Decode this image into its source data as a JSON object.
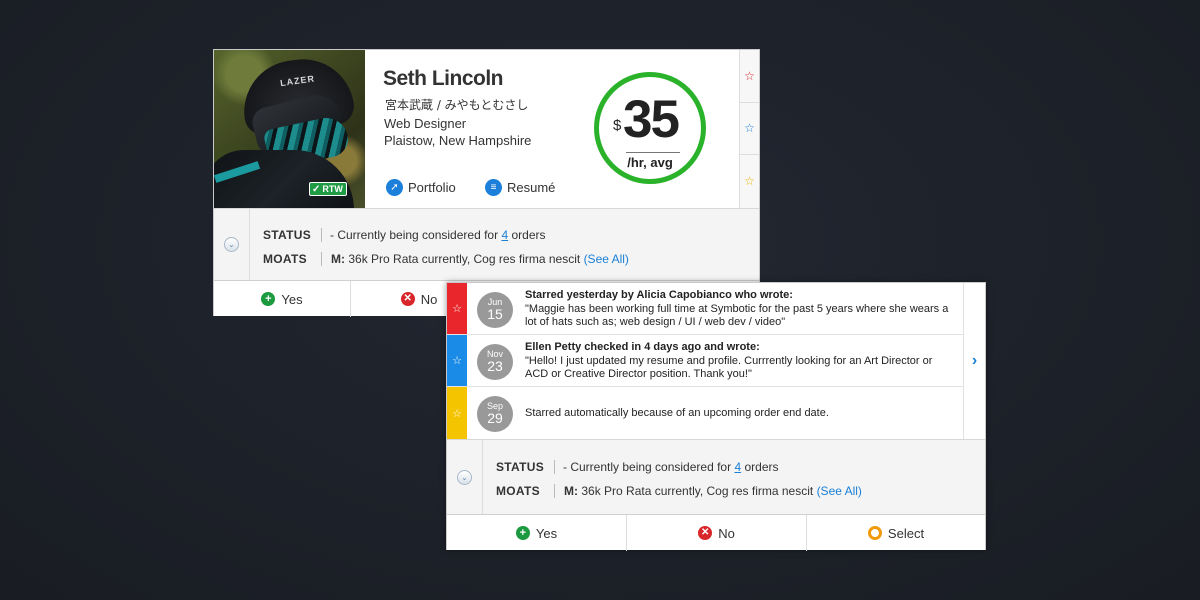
{
  "profile": {
    "name": "Seth Lincoln",
    "name_jp": "宮本武蔵 / みやもとむさし",
    "title": "Web Designer",
    "location": "Plaistow, New Hampshire",
    "badge": "RTW",
    "helmet_brand": "LAZER",
    "portfolio_label": "Portfolio",
    "resume_label": "Resumé",
    "rate": {
      "currency": "$",
      "amount": "35",
      "unit": "/hr, avg",
      "ring_color": "#2ab32a"
    },
    "stars": [
      {
        "icon": "star-outline-icon",
        "color": "#d8262b"
      },
      {
        "icon": "star-outline-icon",
        "color": "#1a7fd6"
      },
      {
        "icon": "star-outline-icon",
        "color": "#e6b800"
      }
    ]
  },
  "status1": {
    "status_label": "STATUS",
    "status_prefix": "- Currently being considered for",
    "status_count": "4",
    "status_suffix": "orders",
    "moats_label": "MOATS",
    "moats_key": "M:",
    "moats_text": "36k Pro Rata currently, Cog res firma nescit",
    "see_all": "(See All)"
  },
  "actions1": {
    "yes": "Yes",
    "no": "No"
  },
  "feed": [
    {
      "bar_color": "#e8262b",
      "month": "Jun",
      "day": "15",
      "headline": "Starred yesterday by Alicia Capobianco who wrote:",
      "body": "\"Maggie has been working full time at Symbotic for the past 5 years where she wears a lot of hats such as; web design / UI / web dev / video\""
    },
    {
      "bar_color": "#1a8be6",
      "month": "Nov",
      "day": "23",
      "headline": "Ellen Petty checked in 4 days ago and wrote:",
      "body": "\"Hello! I just updated my resume and profile. Currrently looking for an Art Director or ACD or Creative Director position. Thank you!\""
    },
    {
      "bar_color": "#f5c400",
      "month": "Sep",
      "day": "29",
      "headline": "",
      "body": "Starred automatically because of an upcoming order end date."
    }
  ],
  "status2": {
    "status_label": "STATUS",
    "status_prefix": "- Currently being considered for",
    "status_count": "4",
    "status_suffix": "orders",
    "moats_label": "MOATS",
    "moats_key": "M:",
    "moats_text": "36k Pro Rata currently, Cog res firma nescit",
    "see_all": "(See All)"
  },
  "actions2": {
    "yes": "Yes",
    "no": "No",
    "select": "Select"
  }
}
